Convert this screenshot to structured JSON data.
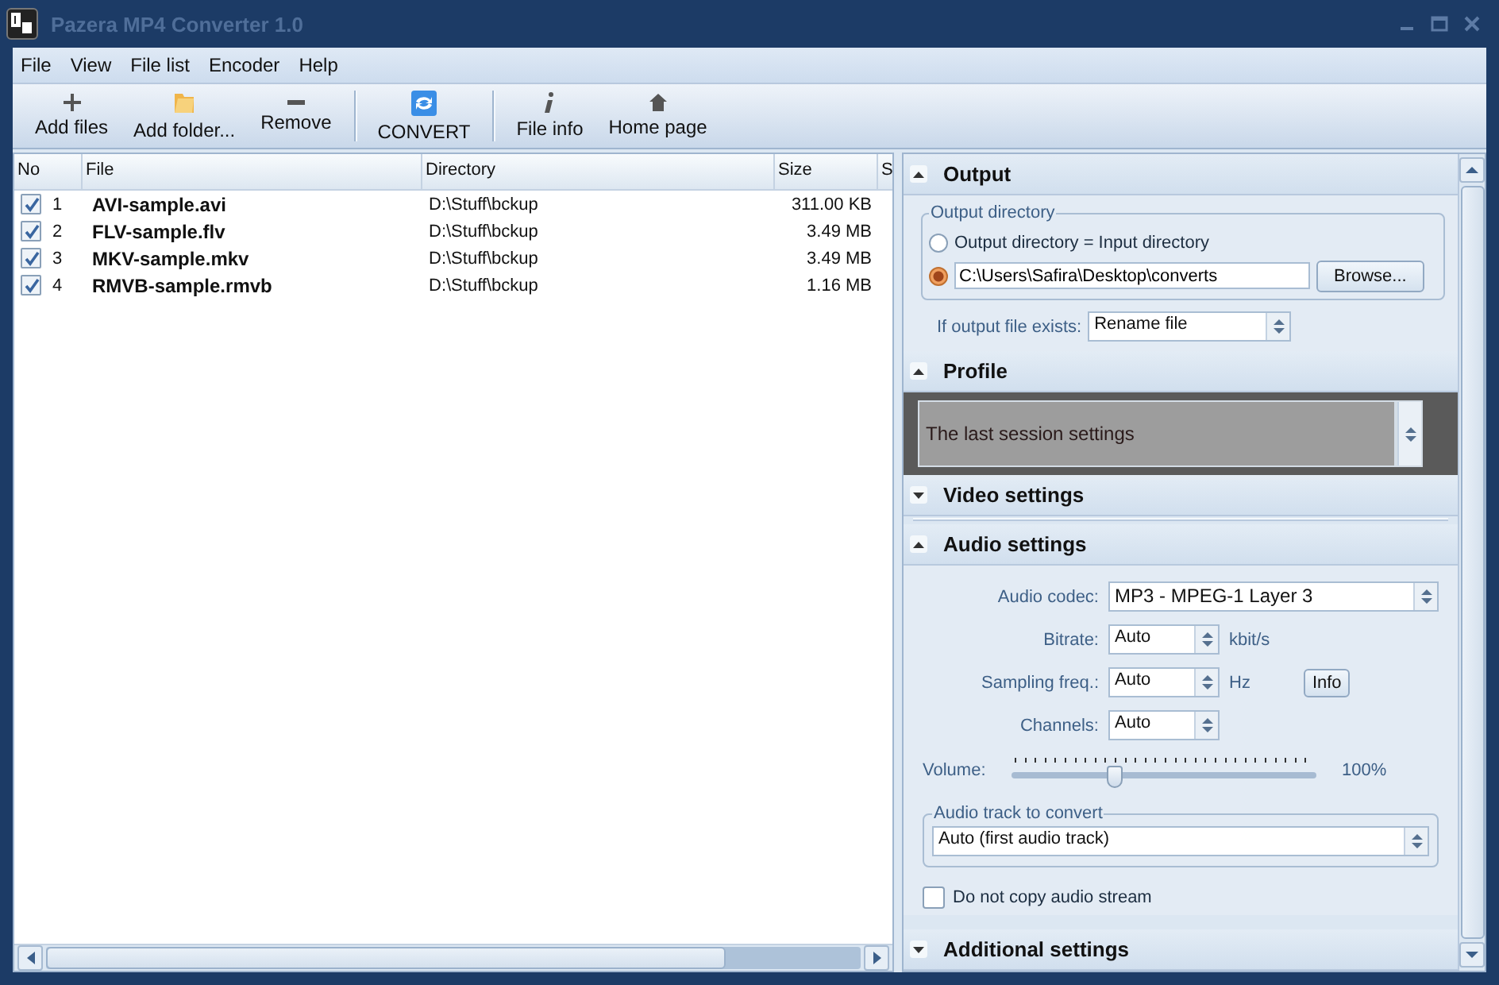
{
  "window": {
    "title": "Pazera MP4 Converter 1.0"
  },
  "menu": [
    "File",
    "View",
    "File list",
    "Encoder",
    "Help"
  ],
  "toolbar": [
    {
      "label": "Add files",
      "kind": "plus"
    },
    {
      "label": "Add folder...",
      "kind": "folder"
    },
    {
      "label": "Remove",
      "kind": "minus"
    },
    {
      "label": "CONVERT",
      "kind": "convert"
    },
    {
      "label": "File info",
      "kind": "info"
    },
    {
      "label": "Home page",
      "kind": "home"
    }
  ],
  "file_list": {
    "columns": [
      "No",
      "File",
      "Directory",
      "Size",
      "S"
    ],
    "rows": [
      {
        "checked": true,
        "no": "1",
        "file": "AVI-sample.avi",
        "directory": "D:\\Stuff\\bckup",
        "size": "311.00 KB"
      },
      {
        "checked": true,
        "no": "2",
        "file": "FLV-sample.flv",
        "directory": "D:\\Stuff\\bckup",
        "size": "3.49 MB"
      },
      {
        "checked": true,
        "no": "3",
        "file": "MKV-sample.mkv",
        "directory": "D:\\Stuff\\bckup",
        "size": "3.49 MB"
      },
      {
        "checked": true,
        "no": "4",
        "file": "RMVB-sample.rmvb",
        "directory": "D:\\Stuff\\bckup",
        "size": "1.16 MB"
      }
    ]
  },
  "sections": [
    {
      "kind": "output",
      "title": "Output",
      "expanded": true,
      "group_title": "Output directory",
      "options": [
        {
          "kind": "label",
          "label": "Output directory = Input directory",
          "selected": false
        },
        {
          "kind": "path",
          "value": "C:\\Users\\Safira\\Desktop\\converts",
          "selected": true
        }
      ],
      "browse": "Browse...",
      "exists_label": "If output file exists:",
      "exists_value": "Rename file"
    },
    {
      "kind": "profile",
      "title": "Profile",
      "expanded": true,
      "value": "The last session settings"
    },
    {
      "kind": "video",
      "title": "Video settings",
      "expanded": false
    },
    {
      "kind": "audio",
      "title": "Audio settings",
      "expanded": true,
      "codec_label": "Audio codec:",
      "codec": "MP3 - MPEG-1 Layer 3",
      "fields": [
        {
          "label": "Bitrate:",
          "value": "Auto",
          "unit": "kbit/s"
        },
        {
          "label": "Sampling freq.:",
          "value": "Auto",
          "unit": "Hz",
          "button": "Info"
        },
        {
          "label": "Channels:",
          "value": "Auto"
        }
      ],
      "volume": {
        "label": "Volume:",
        "level": 0.34,
        "reading": "100%"
      },
      "track_group": "Audio track to convert",
      "track": "Auto (first audio track)",
      "no_copy": {
        "label": "Do not copy audio stream",
        "checked": false
      }
    },
    {
      "kind": "additional",
      "title": "Additional settings",
      "expanded": false
    }
  ]
}
